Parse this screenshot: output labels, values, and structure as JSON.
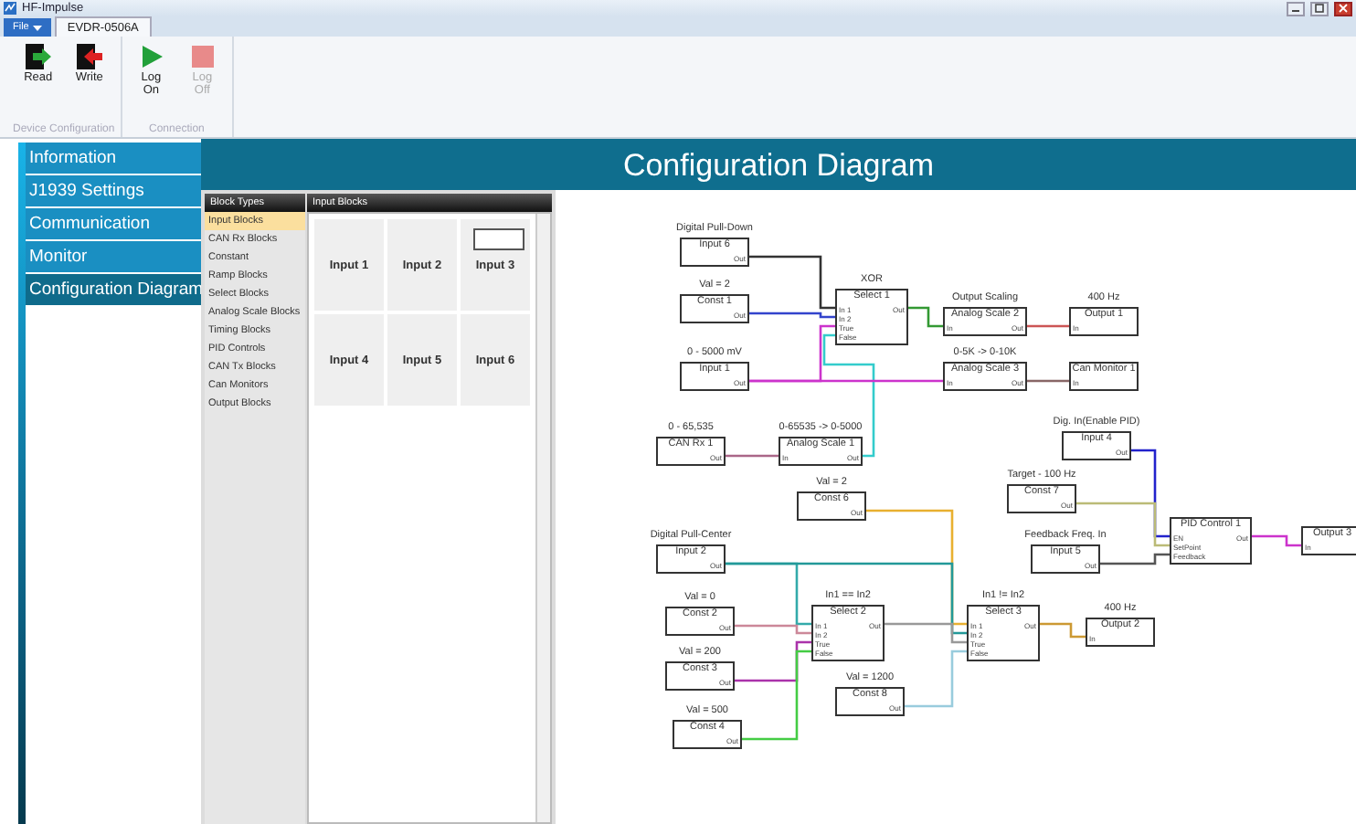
{
  "window": {
    "title": "HF-Impulse"
  },
  "file_menu": {
    "label": "File"
  },
  "document_tab": {
    "label": "EVDR-0506A",
    "selected": true
  },
  "ribbon": {
    "groups": [
      {
        "label": "Device Configuration",
        "buttons": [
          {
            "label": "Read",
            "kind": "read",
            "disabled": false
          },
          {
            "label": "Write",
            "kind": "write",
            "disabled": false
          }
        ]
      },
      {
        "label": "Connection",
        "buttons": [
          {
            "label": "Log On",
            "kind": "start",
            "disabled": false
          },
          {
            "label": "Log Off",
            "kind": "stop",
            "disabled": true
          }
        ]
      }
    ]
  },
  "nav": [
    {
      "label": "Information",
      "selected": false
    },
    {
      "label": "J1939 Settings",
      "selected": false
    },
    {
      "label": "Communication",
      "selected": false
    },
    {
      "label": "Monitor",
      "selected": false
    },
    {
      "label": "Configuration Diagram",
      "selected": true
    }
  ],
  "header": {
    "title": "Configuration Diagram"
  },
  "palette": {
    "types_heading": "Block Types",
    "types": [
      {
        "label": "Input Blocks",
        "selected": true
      },
      {
        "label": "CAN Rx Blocks",
        "selected": false
      },
      {
        "label": "Constant",
        "selected": false
      },
      {
        "label": "Ramp Blocks",
        "selected": false
      },
      {
        "label": "Select Blocks",
        "selected": false
      },
      {
        "label": "Analog Scale Blocks",
        "selected": false
      },
      {
        "label": "Timing Blocks",
        "selected": false
      },
      {
        "label": "PID Controls",
        "selected": false
      },
      {
        "label": "CAN Tx Blocks",
        "selected": false
      },
      {
        "label": "Can Monitors",
        "selected": false
      },
      {
        "label": "Output Blocks",
        "selected": false
      }
    ],
    "blocks_heading": "Input Blocks",
    "blocks": [
      {
        "label": "Input 1",
        "preview": false
      },
      {
        "label": "Input 2",
        "preview": false
      },
      {
        "label": "Input 3",
        "preview": true
      },
      {
        "label": "Input 4",
        "preview": false
      },
      {
        "label": "Input 5",
        "preview": false
      },
      {
        "label": "Input 6",
        "preview": false
      }
    ]
  },
  "diagram": {
    "blocks": [
      {
        "caption": "Digital Pull-Down",
        "name": "Input 6",
        "output": "Out"
      },
      {
        "caption": "Val = 2",
        "name": "Const 1",
        "output": "Out"
      },
      {
        "caption": "XOR",
        "name": "Select 1",
        "inputs": [
          "In 1",
          "In 2",
          "True",
          "False"
        ],
        "output": "Out"
      },
      {
        "caption": "Output Scaling",
        "name": "Analog Scale 2",
        "inputs": [
          "In"
        ],
        "output": "Out"
      },
      {
        "caption": "400 Hz",
        "name": "Output 1",
        "inputs": [
          "In"
        ]
      },
      {
        "caption": "0 - 5000 mV",
        "name": "Input 1",
        "output": "Out"
      },
      {
        "caption": "0-5K -> 0-10K",
        "name": "Analog Scale 3",
        "inputs": [
          "In"
        ],
        "output": "Out"
      },
      {
        "name": "Can Monitor 1",
        "inputs": [
          "In"
        ]
      },
      {
        "caption": "0 - 65,535",
        "name": "CAN Rx 1",
        "output": "Out"
      },
      {
        "caption": "0-65535 -> 0-5000",
        "name": "Analog Scale 1",
        "inputs": [
          "In"
        ],
        "output": "Out"
      },
      {
        "caption": "Dig. In(Enable PID)",
        "name": "Input 4",
        "output": "Out"
      },
      {
        "caption": "Val = 2",
        "name": "Const 6",
        "output": "Out"
      },
      {
        "caption": "Target - 100 Hz",
        "name": "Const 7",
        "output": "Out"
      },
      {
        "caption": "Digital Pull-Center",
        "name": "Input 2",
        "output": "Out"
      },
      {
        "caption": "Feedback Freq. In",
        "name": "Input 5",
        "output": "Out"
      },
      {
        "name": "PID Control 1",
        "inputs": [
          "EN",
          "SetPoint",
          "Feedback"
        ],
        "output": "Out"
      },
      {
        "name": "Output 3",
        "inputs": [
          "In"
        ]
      },
      {
        "caption": "Val = 0",
        "name": "Const 2",
        "output": "Out"
      },
      {
        "caption": "In1 == In2",
        "name": "Select 2",
        "inputs": [
          "In 1",
          "In 2",
          "True",
          "False"
        ],
        "output": "Out"
      },
      {
        "caption": "In1 != In2",
        "name": "Select 3",
        "inputs": [
          "In 1",
          "In 2",
          "True",
          "False"
        ],
        "output": "Out"
      },
      {
        "caption": "400 Hz",
        "name": "Output 2",
        "inputs": [
          "In"
        ]
      },
      {
        "caption": "Val = 200",
        "name": "Const 3",
        "output": "Out"
      },
      {
        "caption": "Val = 1200",
        "name": "Const 8",
        "output": "Out"
      },
      {
        "caption": "Val = 500",
        "name": "Const 4",
        "output": "Out"
      }
    ]
  }
}
